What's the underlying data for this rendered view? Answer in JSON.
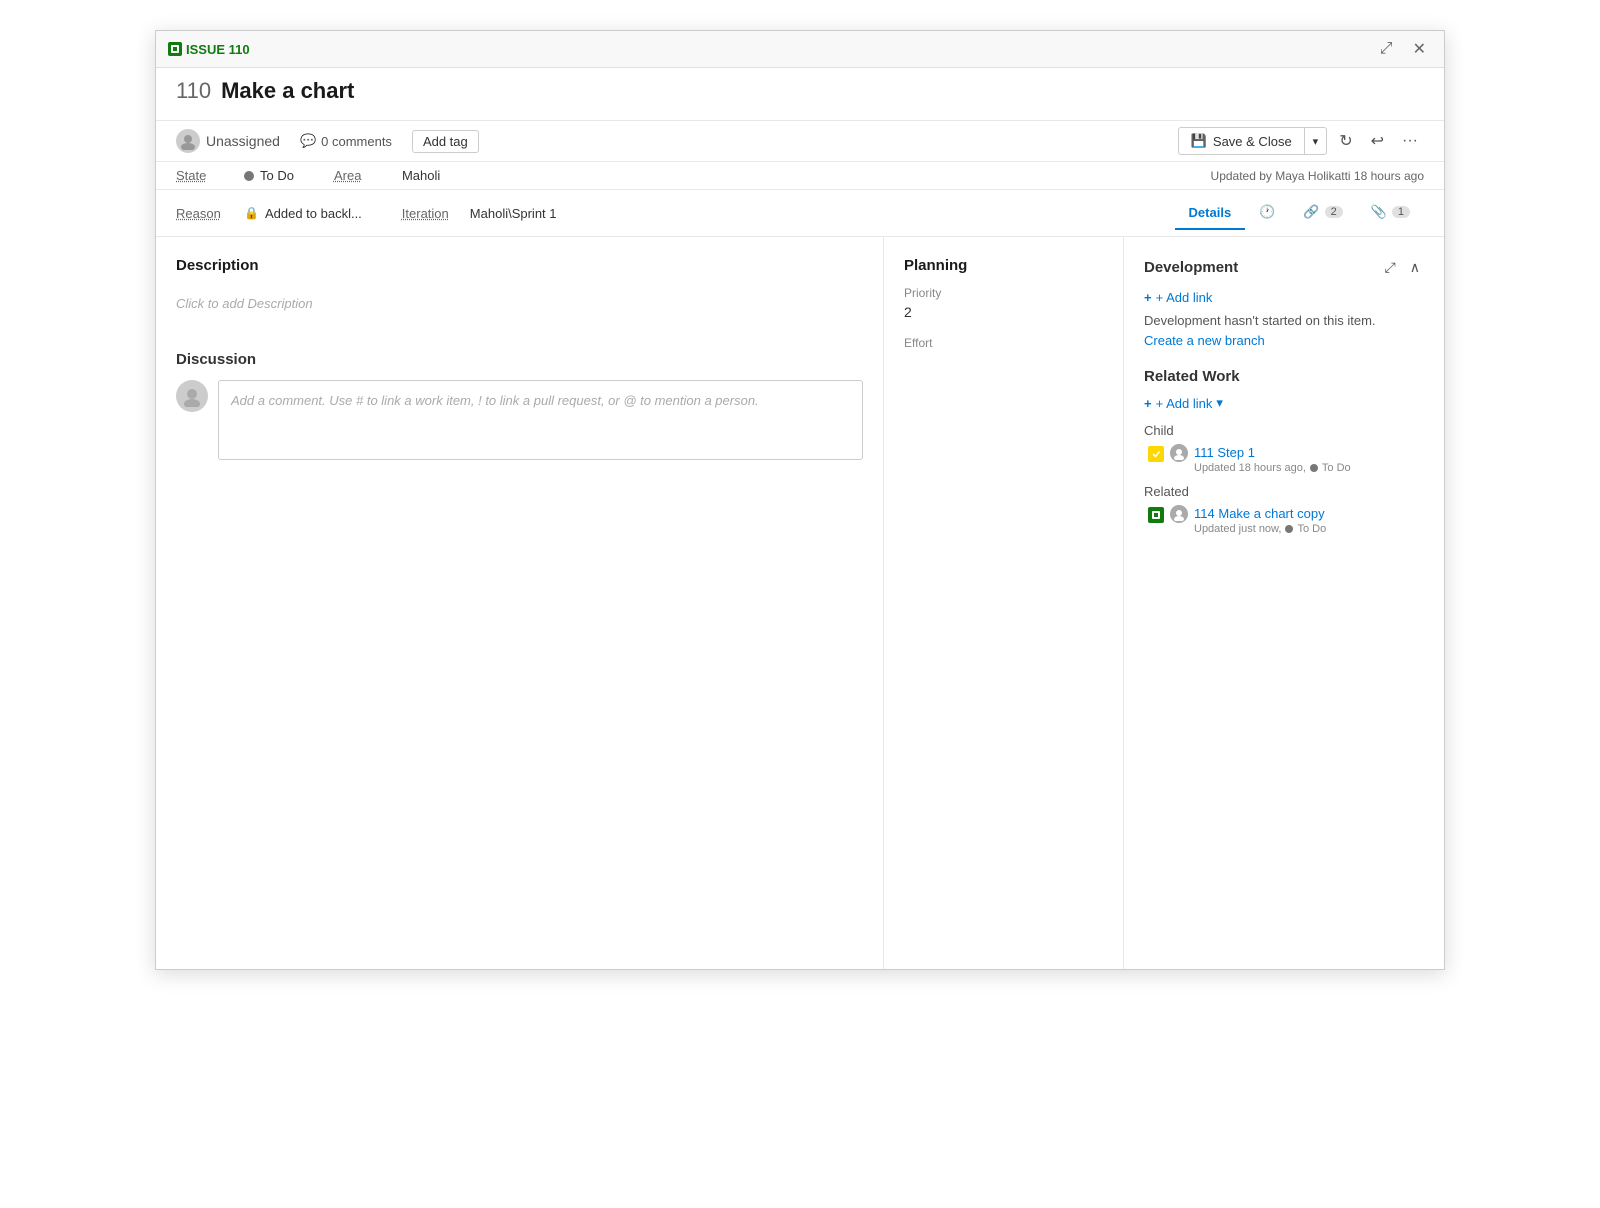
{
  "window": {
    "issue_badge": "ISSUE 110",
    "title_number": "110",
    "title_text": "Make a chart",
    "expand_icon": "⤢",
    "close_icon": "✕"
  },
  "toolbar": {
    "assignee": "Unassigned",
    "comments_count": "0 comments",
    "add_tag_label": "Add tag",
    "save_close_label": "Save & Close",
    "refresh_icon": "↻",
    "undo_icon": "↩",
    "more_icon": "···"
  },
  "meta": {
    "state_label": "State",
    "state_value": "To Do",
    "area_label": "Area",
    "area_value": "Maholi",
    "reason_label": "Reason",
    "reason_value": "Added to backl...",
    "iteration_label": "Iteration",
    "iteration_value": "Maholi\\Sprint 1",
    "updated_text": "Updated by Maya Holikatti 18 hours ago"
  },
  "sub_tabs": {
    "details_label": "Details",
    "history_label": "History",
    "links_label": "Links",
    "links_count": "2",
    "attachments_label": "Attachments",
    "attachments_count": "1"
  },
  "description": {
    "section_title": "Description",
    "placeholder": "Click to add Description"
  },
  "discussion": {
    "section_title": "Discussion",
    "comment_placeholder": "Add a comment. Use # to link a work item, ! to link a pull request, or @ to mention a person."
  },
  "planning": {
    "section_title": "Planning",
    "priority_label": "Priority",
    "priority_value": "2",
    "effort_label": "Effort",
    "effort_value": ""
  },
  "development": {
    "section_title": "Development",
    "add_link_label": "+ Add link",
    "info_text": "Development hasn't started on this item.",
    "create_branch_label": "Create a new branch"
  },
  "related_work": {
    "section_title": "Related Work",
    "add_link_label": "+ Add link",
    "child_label": "Child",
    "child_item_id": "111",
    "child_item_title": "Step 1",
    "child_item_meta": "Updated 18 hours ago,",
    "child_item_status": "To Do",
    "related_label": "Related",
    "related_item_id": "114",
    "related_item_title": "Make a chart copy",
    "related_item_meta": "Updated just now,",
    "related_item_status": "To Do"
  },
  "colors": {
    "link_color": "#0078d4",
    "active_tab": "#0078d4",
    "green": "#107c10",
    "state_dot": "#777777"
  }
}
